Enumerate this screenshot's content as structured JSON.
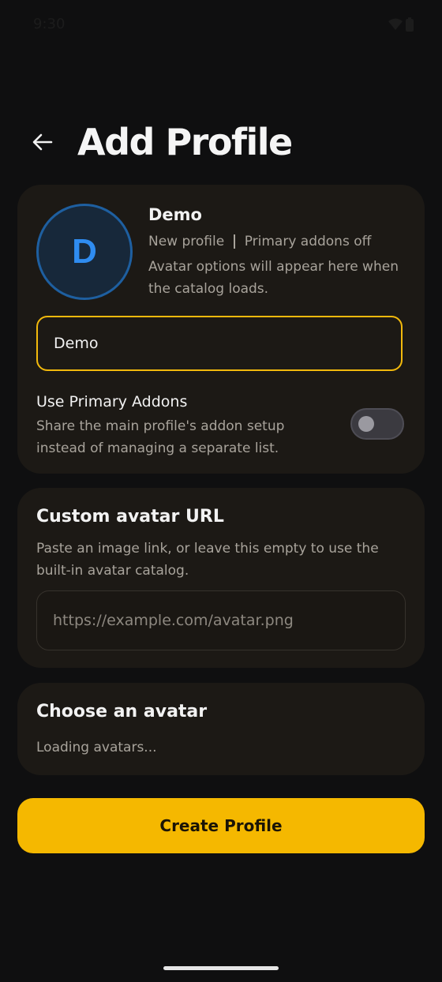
{
  "status_bar": {
    "time": "9:30",
    "icons": [
      "wifi-icon",
      "battery-icon"
    ]
  },
  "header": {
    "title": "Add Profile",
    "back_icon": "arrow-left-icon"
  },
  "profile_card": {
    "avatar_letter": "D",
    "name": "Demo",
    "meta_status": "New profile",
    "meta_addons": "Primary addons off",
    "hint": "Avatar options will appear here when the catalog loads.",
    "name_input_value": "Demo",
    "toggle_title": "Use Primary Addons",
    "toggle_desc": "Share the main profile's addon setup instead of managing a separate list.",
    "toggle_on": false
  },
  "url_card": {
    "title": "Custom avatar URL",
    "description": "Paste an image link, or leave this empty to use the built-in avatar catalog.",
    "placeholder": "https://example.com/avatar.png"
  },
  "avatar_card": {
    "title": "Choose an avatar",
    "status": "Loading avatars..."
  },
  "create_button_label": "Create Profile",
  "colors": {
    "background": "#0f0f10",
    "card": "#1c1915",
    "accent": "#f5b800",
    "avatar_blue": "#2f8cf0"
  }
}
